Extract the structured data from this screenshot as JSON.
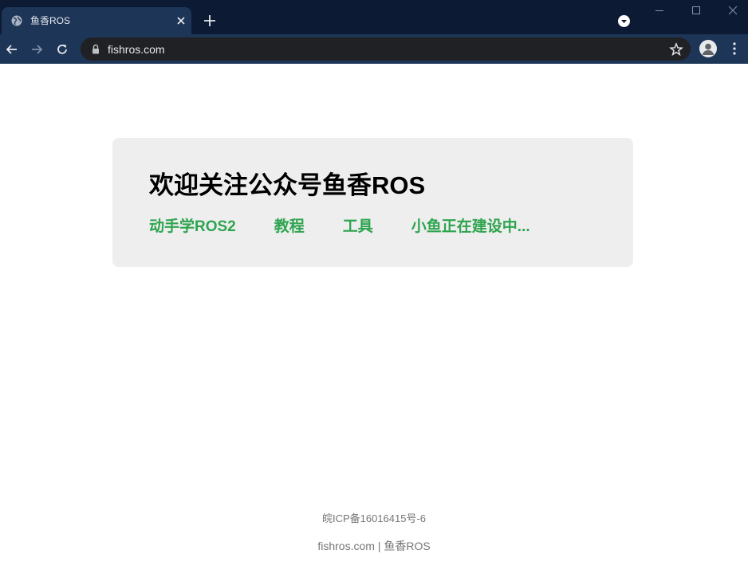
{
  "browser": {
    "tab_title": "鱼香ROS",
    "url": "fishros.com"
  },
  "page": {
    "headline": "欢迎关注公众号鱼香ROS",
    "links": [
      "动手学ROS2",
      "教程",
      "工具",
      "小鱼正在建设中..."
    ],
    "footer": {
      "icp": "皖ICP备16016415号-6",
      "site": "fishros.com",
      "separator": "|",
      "brand": "鱼香ROS"
    }
  },
  "colors": {
    "link": "#2ea44f",
    "card_bg": "#eeeeee",
    "chrome_dark": "#0c1a33",
    "chrome_tab": "#1d3557"
  },
  "icons": [
    "globe-icon",
    "close-icon",
    "plus-icon",
    "dropdown-icon",
    "minimize-icon",
    "maximize-icon",
    "window-close-icon",
    "back-arrow-icon",
    "forward-arrow-icon",
    "reload-icon",
    "lock-icon",
    "star-icon",
    "profile-icon",
    "kebab-menu-icon"
  ]
}
